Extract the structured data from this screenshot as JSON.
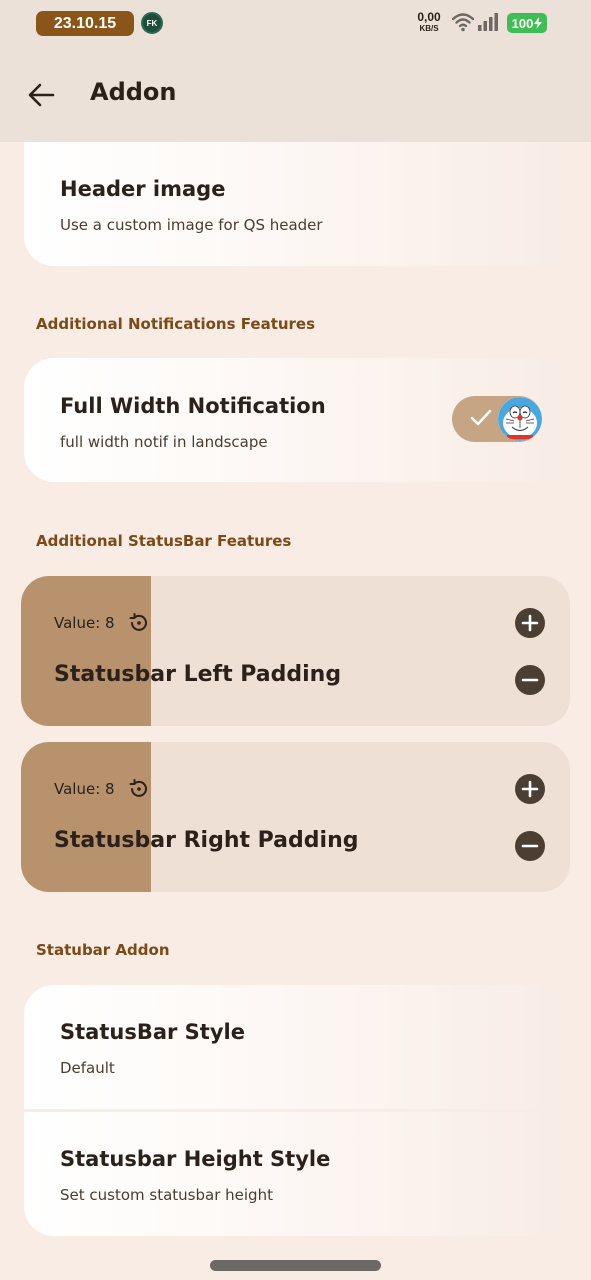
{
  "status_bar": {
    "time": "23.10.15",
    "notif_badge": "FK",
    "net_speed_value": "0,00",
    "net_speed_unit": "KB/S",
    "battery": "100",
    "wifi_icon": "wifi-icon",
    "signal_icon": "signal-icon"
  },
  "app_bar": {
    "title": "Addon",
    "back_icon": "arrow-left-icon"
  },
  "header_image": {
    "title": "Header image",
    "subtitle": "Use a custom image for QS header"
  },
  "section_notifications": {
    "header": "Additional Notifications Features",
    "items": [
      {
        "title": "Full Width Notification",
        "subtitle": "full width notif in landscape",
        "toggle_on": true
      }
    ]
  },
  "section_statusbar": {
    "header": "Additional StatusBar Features",
    "sliders": [
      {
        "value_label": "Value: 8",
        "title": "Statusbar Left Padding",
        "fill_fraction": 0.237
      },
      {
        "value_label": "Value: 8",
        "title": "Statusbar Right Padding",
        "fill_fraction": 0.237
      }
    ]
  },
  "section_statubar_addon": {
    "header": "Statubar Addon",
    "items": [
      {
        "title": "StatusBar Style",
        "subtitle": "Default"
      },
      {
        "title": "Statusbar Height Style",
        "subtitle": "Set custom statusbar height"
      }
    ]
  },
  "colors": {
    "accent": "#7b4a16",
    "slider_fill": "#b8926c",
    "toggle_on": "#c6a584",
    "background": "#f8ece5"
  }
}
